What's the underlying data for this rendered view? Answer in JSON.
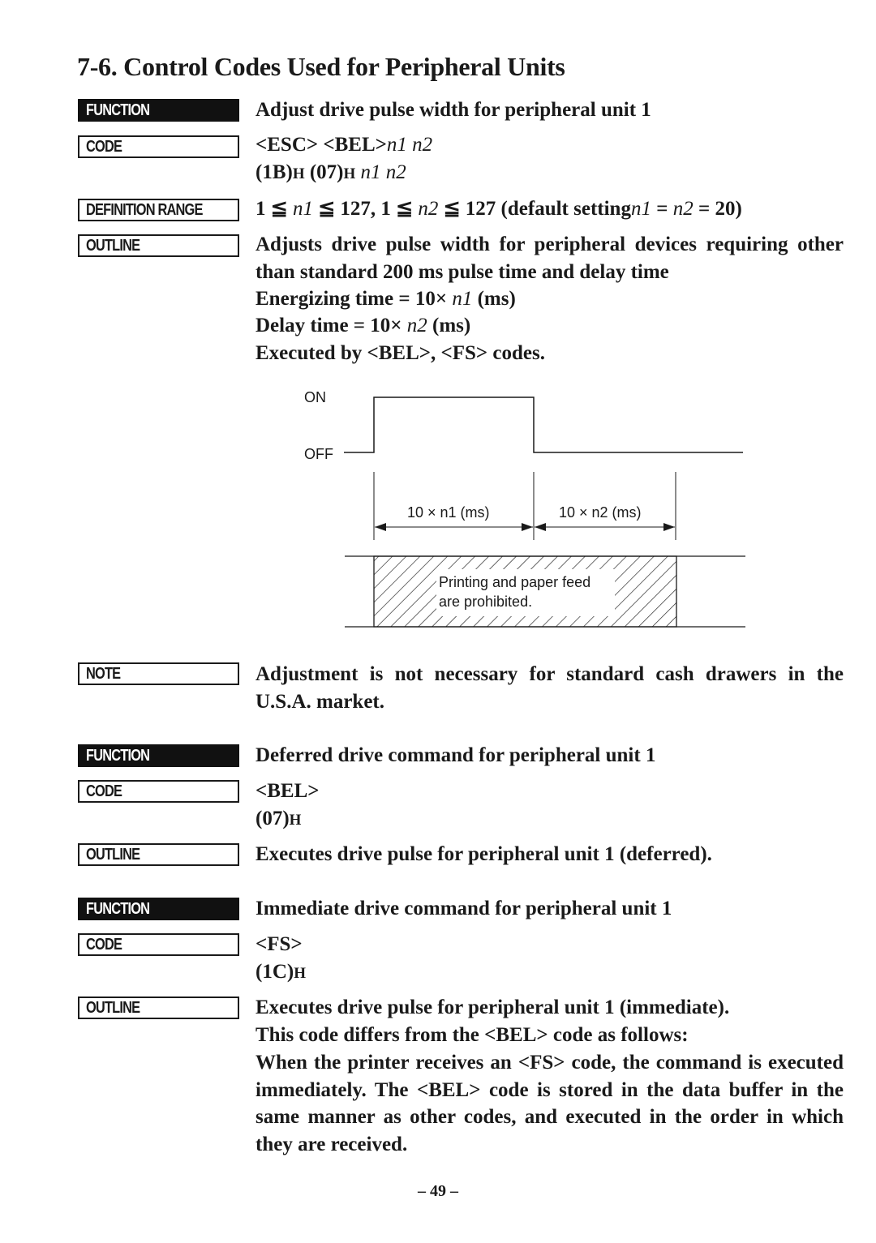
{
  "page": {
    "title": "7-6.  Control Codes Used for Peripheral Units",
    "page_number": "– 49 –"
  },
  "labels": {
    "function": "FUNCTION",
    "code": "CODE",
    "definition_range": "DEFINITION RANGE",
    "outline": "OUTLINE",
    "note": "NOTE"
  },
  "section1": {
    "function": "Adjust drive pulse width for peripheral unit 1",
    "code_line1_main": "<ESC> <BEL>",
    "code_line1_args": "n1 n2",
    "code_line2_a": "(1B)",
    "code_line2_h1": "H",
    "code_line2_b": " (07)",
    "code_line2_h2": "H",
    "code_line2_args": " n1 n2",
    "range_p1": "1 ≦ ",
    "range_n1": "n1",
    "range_p2": " ≦ 127, 1 ≦ ",
    "range_n2": "n2",
    "range_p3": " ≦ 127 (default setting",
    "range_n1b": "n1",
    "range_p4": " = ",
    "range_n2b": "n2",
    "range_p5": " = 20)",
    "outline_lines": [
      "Adjusts drive pulse width for peripheral devices requiring other than standard 200 ms pulse time and delay time"
    ],
    "energizing_prefix": "Energizing time = 10× ",
    "energizing_var": "n1",
    "energizing_suffix": " (ms)",
    "delay_prefix": "Delay time = 10× ",
    "delay_var": "n2",
    "delay_suffix": " (ms)",
    "executed": "Executed by <BEL>, <FS> codes.",
    "note": "Adjustment is not necessary for standard cash drawers in the U.S.A. market."
  },
  "diagram": {
    "on_label": "ON",
    "off_label": "OFF",
    "n1_label": "10 × n1 (ms)",
    "n2_label": "10 × n2 (ms)",
    "prohibited_line1": "Printing and paper feed",
    "prohibited_line2": "are prohibited."
  },
  "section2": {
    "function": "Deferred drive command for peripheral unit 1",
    "code_line1": "<BEL>",
    "code_line2": "(07)",
    "code_line2_h": "H",
    "outline": "Executes drive pulse for peripheral unit 1 (deferred)."
  },
  "section3": {
    "function": "Immediate drive command for peripheral unit 1",
    "code_line1": "<FS>",
    "code_line2": "(1C)",
    "code_line2_h": "H",
    "outline_line1": "Executes drive pulse for peripheral unit 1 (immediate).",
    "outline_line2": "This code differs from the <BEL> code as follows:",
    "outline_para": "When the printer receives an <FS> code, the command is executed immediately. The <BEL> code is stored in the data buffer in the same manner as other codes, and executed in the order in which they are received."
  }
}
